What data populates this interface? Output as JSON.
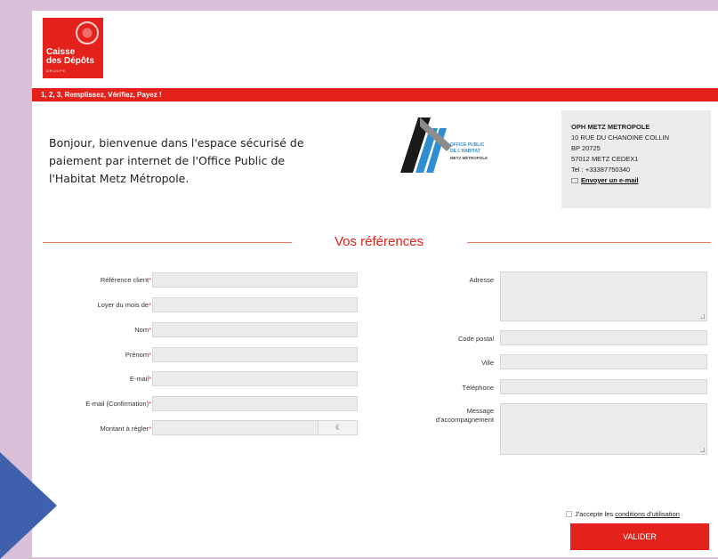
{
  "brand": {
    "logo_line1": "Caisse",
    "logo_line2": "des Dépôts",
    "logo_sub": "GROUPE",
    "accent_color": "#e4211b",
    "arrow_color": "#3f61ad"
  },
  "banner": {
    "steps": "1, 2, 3, Remplissez, Vérifiez, Payez !"
  },
  "welcome": {
    "text": "Bonjour, bienvenue dans l'espace sécurisé de paiement par internet de l'Office Public de l'Habitat Metz Métropole."
  },
  "office_logo": {
    "line1": "OFFICE PUBLIC",
    "line2": "DE L'HABITAT",
    "line3": "METZ MÉTROPOLE"
  },
  "contact": {
    "org": "OPH METZ METROPOLE",
    "address": "10 RUE DU CHANOINE COLLIN",
    "bp": "BP 20725",
    "city": "57012 METZ CEDEX1",
    "tel": "Tel : +33387750340",
    "email_link": "Envoyer un e-mail"
  },
  "section": {
    "title": "Vos références"
  },
  "left_fields": [
    {
      "label": "Référence client",
      "required": "*",
      "value": ""
    },
    {
      "label": "Loyer du mois de",
      "required": "*",
      "value": ""
    },
    {
      "label": "Nom",
      "required": "*",
      "value": ""
    },
    {
      "label": "Prénom",
      "required": "*",
      "value": ""
    },
    {
      "label": "E-mail",
      "required": "*",
      "value": ""
    },
    {
      "label": "E-mail (Confirmation)",
      "required": "*",
      "value": ""
    },
    {
      "label": "Montant à régler",
      "required": "*",
      "value": "",
      "currency": "€"
    }
  ],
  "right_fields": [
    {
      "label": "Adresse",
      "value": ""
    },
    {
      "label": "Code postal",
      "value": ""
    },
    {
      "label": "Ville",
      "value": ""
    },
    {
      "label": "Téléphone",
      "value": ""
    },
    {
      "label_line1": "Message",
      "label_line2": "d'accompagnement",
      "value": ""
    }
  ],
  "terms": {
    "prefix": "J'accepte les ",
    "link": "conditions d'utilisation",
    "checked": false
  },
  "submit": {
    "label": "VALIDER"
  }
}
